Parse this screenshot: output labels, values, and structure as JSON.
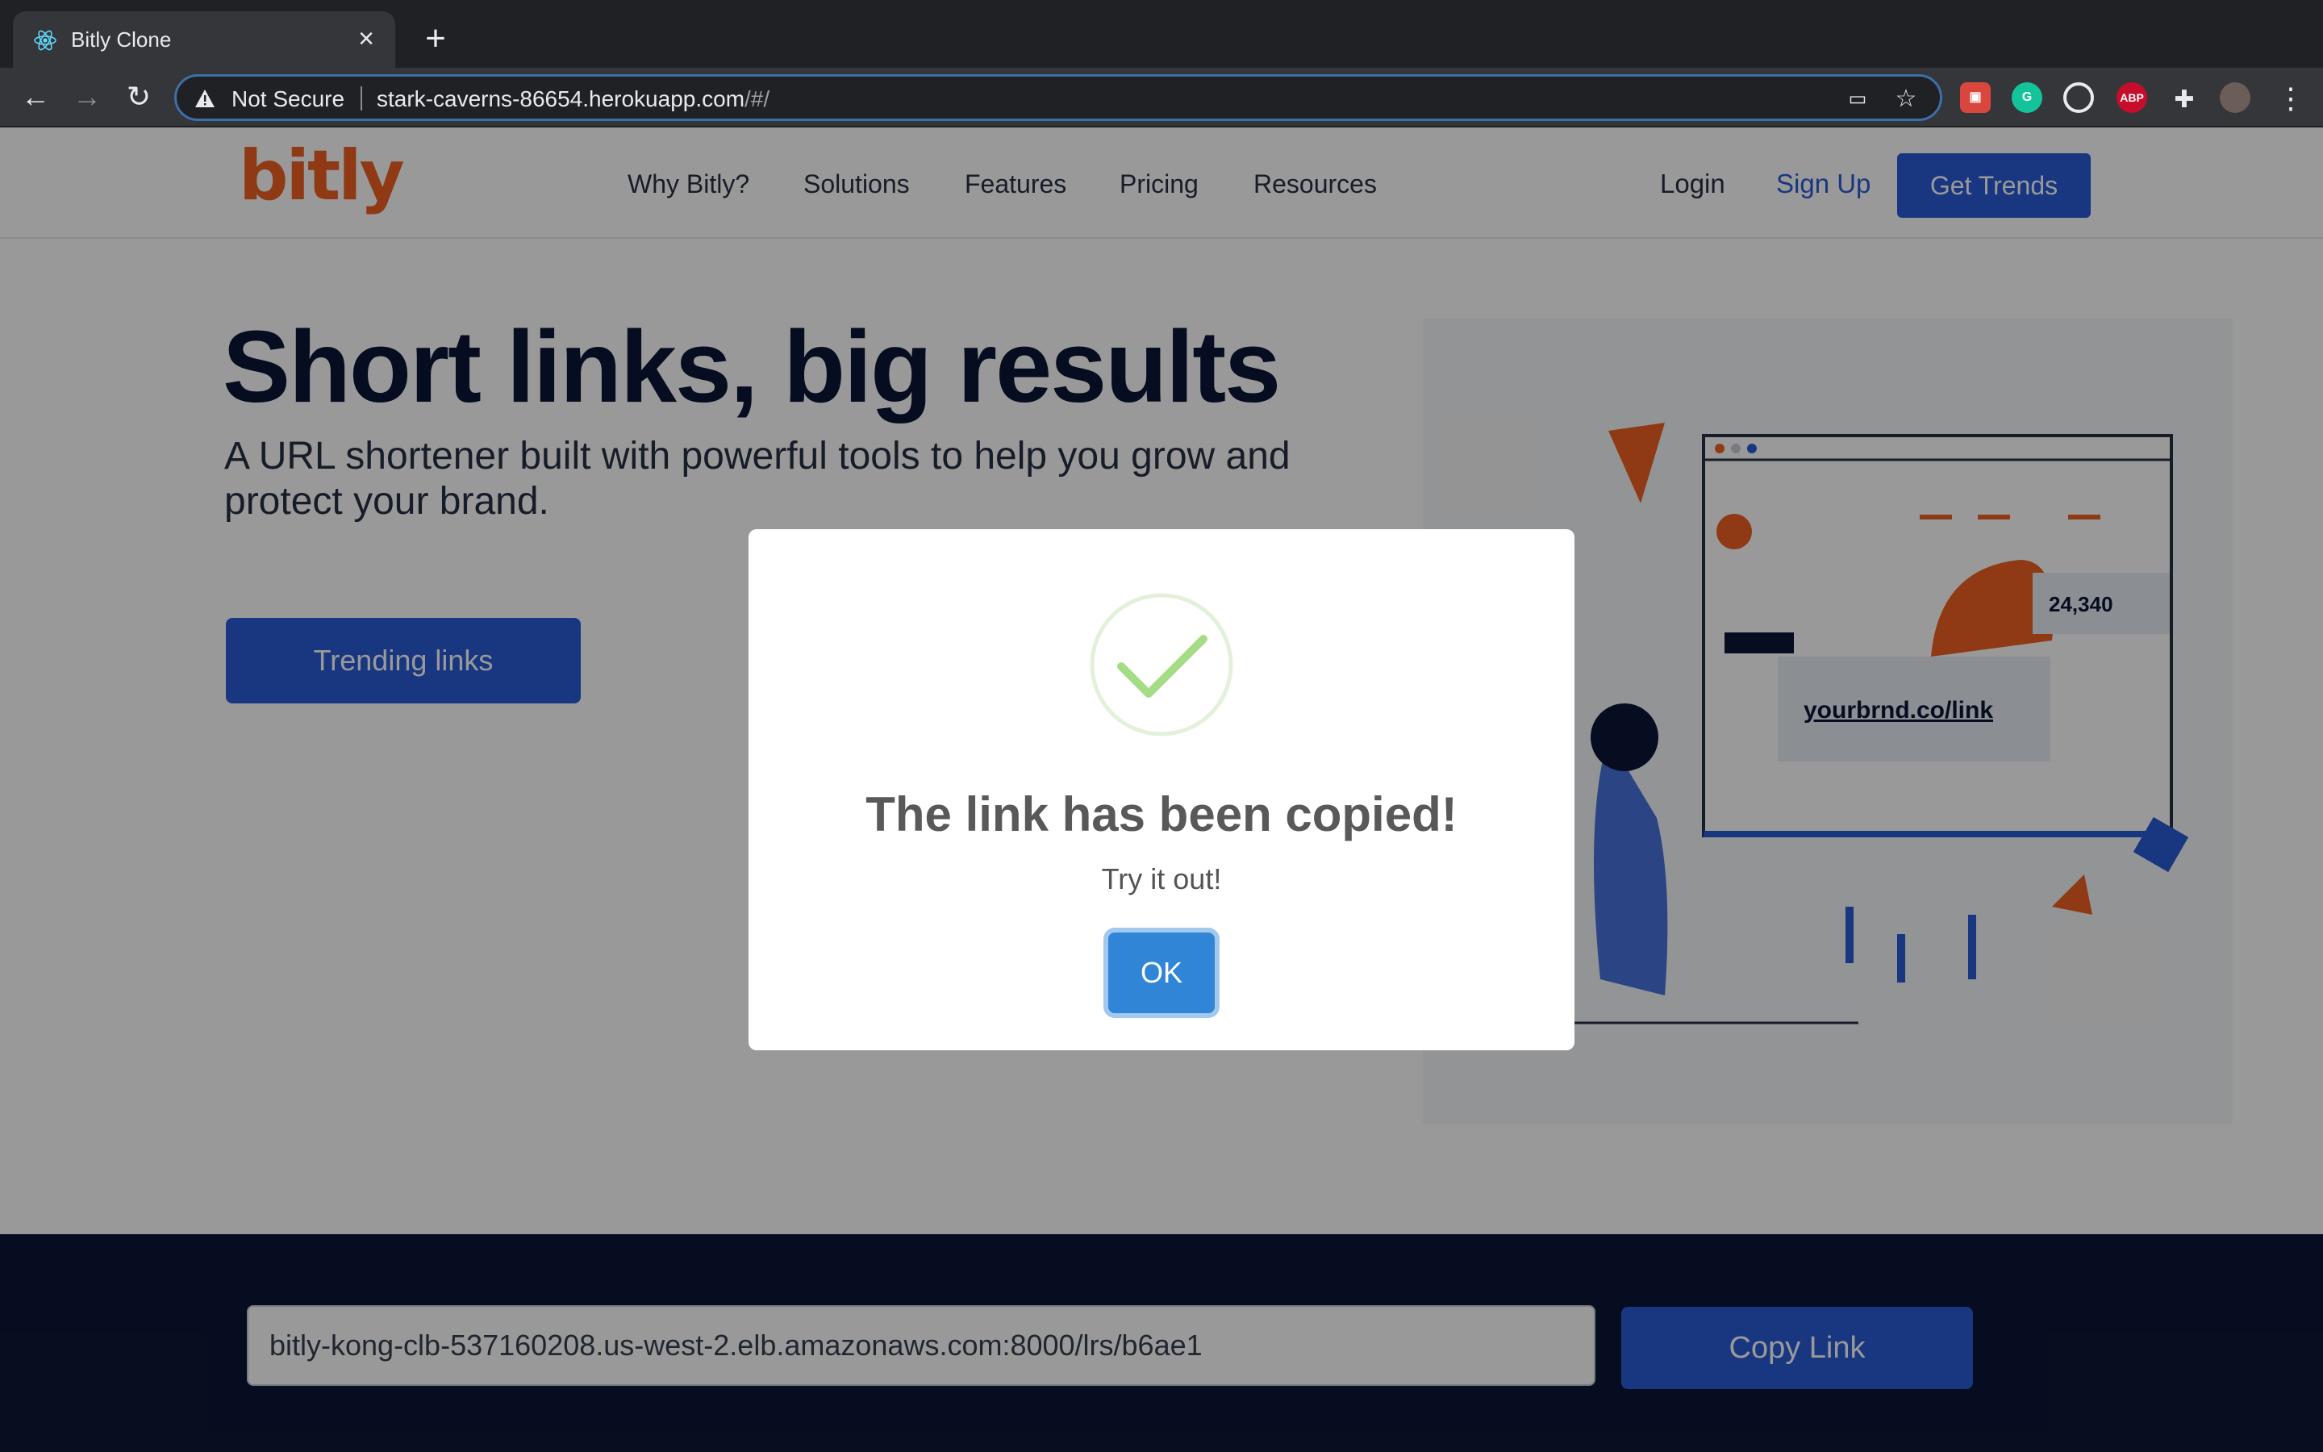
{
  "browser": {
    "tab_title": "Bitly Clone",
    "tab_close_icon": "close-icon",
    "new_tab_icon": "plus-icon",
    "security_label": "Not Secure",
    "url_host": "stark-caverns-86654.herokuapp.com",
    "url_path": "/#/",
    "extensions": [
      {
        "name": "ext-1",
        "color": "#d9463e"
      },
      {
        "name": "grammarly",
        "label": "G",
        "color": "#15c39a"
      },
      {
        "name": "ext-target",
        "color": "#5f6368"
      },
      {
        "name": "adblock-plus",
        "label": "ABP",
        "color": "#c70d2c"
      }
    ]
  },
  "site": {
    "logo": "bitly",
    "nav": [
      "Why Bitly?",
      "Solutions",
      "Features",
      "Pricing",
      "Resources"
    ],
    "login": "Login",
    "signup": "Sign Up",
    "cta": "Get Trends",
    "brand_color": "#2a5bd7",
    "logo_color": "#ee6123"
  },
  "hero": {
    "title": "Short links, big results",
    "subtitle": "A URL shortener built with powerful tools to help you grow and protect your brand.",
    "button": "Trending links",
    "illustration": {
      "stat": "24,340",
      "link": "yourbrnd.co/link"
    }
  },
  "shortener": {
    "result_value": "bitly-kong-clb-537160208.us-west-2.elb.amazonaws.com:8000/lrs/b6ae1",
    "copy_label": "Copy Link"
  },
  "modal": {
    "icon": "checkmark-success-icon",
    "title": "The link has been copied!",
    "text": "Try it out!",
    "ok_label": "OK"
  }
}
